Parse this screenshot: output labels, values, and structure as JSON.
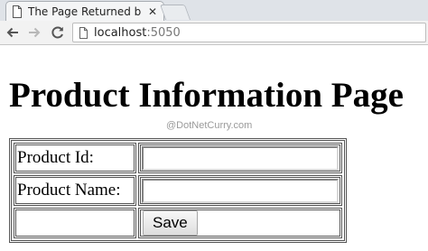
{
  "browser": {
    "tab_title": "The Page Returned b",
    "tab_icon": "page-icon",
    "close_icon": "close-icon",
    "nav_icons": [
      "back-arrow-icon",
      "forward-arrow-icon",
      "reload-icon"
    ],
    "address": {
      "host": "localhost",
      "port": ":5050"
    }
  },
  "page": {
    "heading": "Product Information Page",
    "watermark": "@DotNetCurry.com"
  },
  "form": {
    "product_id_label": "Product Id:",
    "product_id_value": "",
    "product_name_label": "Product Name:",
    "product_name_value": "",
    "save_label": "Save"
  },
  "colors": {
    "tabstrip": "#dfe3e8",
    "toolbar": "#f2f2f2",
    "watermark": "#9a9a9a"
  }
}
